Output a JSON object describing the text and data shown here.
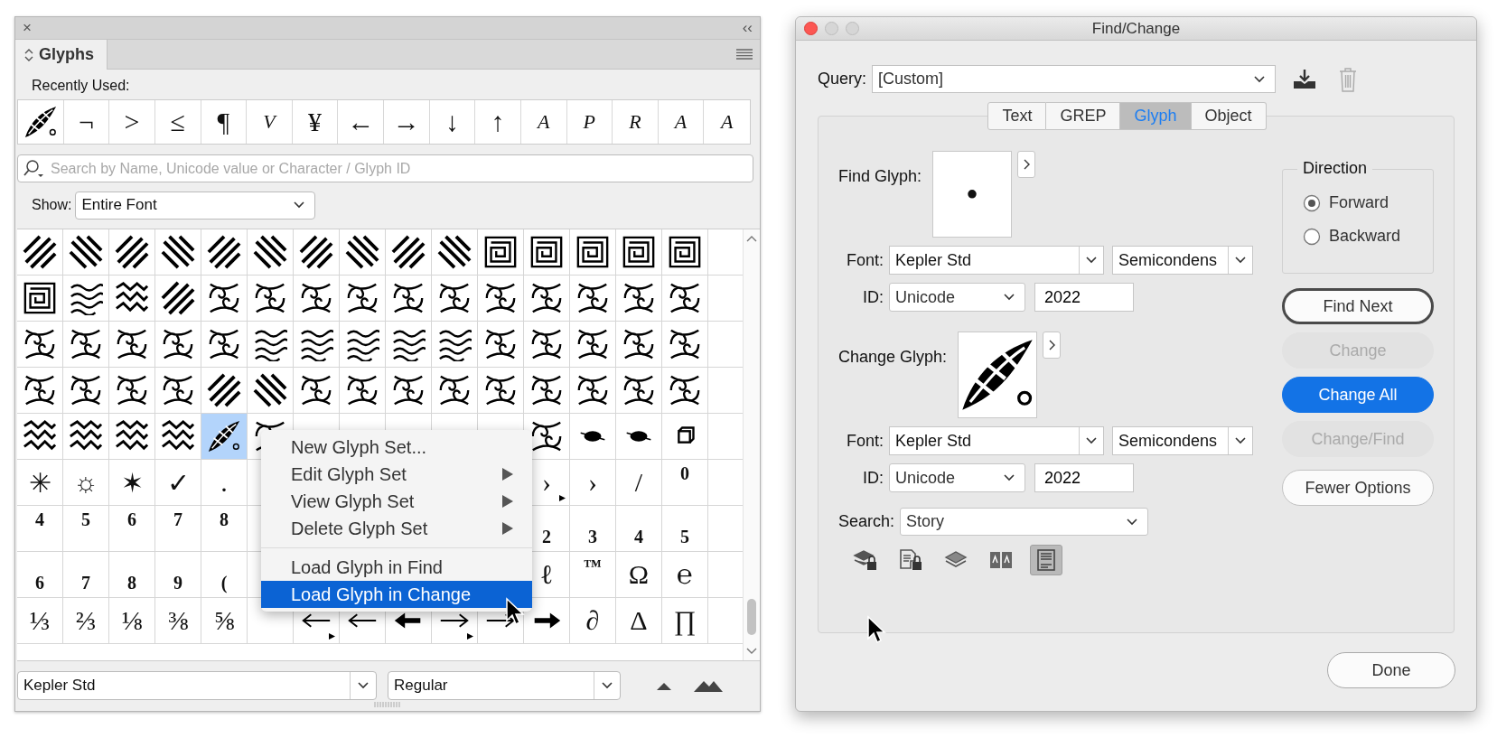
{
  "glyphs_panel": {
    "close_button": "×",
    "collapse_button": "‹‹",
    "tab": {
      "label": "Glyphs",
      "selected": true
    },
    "recently_used_label": "Recently Used:",
    "recently_used": [
      {
        "kind": "leaf"
      },
      {
        "kind": "char",
        "char": "¬"
      },
      {
        "kind": "char",
        "char": ">"
      },
      {
        "kind": "char",
        "char": "≤"
      },
      {
        "kind": "char",
        "char": "¶"
      },
      {
        "kind": "script",
        "char": "V"
      },
      {
        "kind": "char",
        "char": "¥"
      },
      {
        "kind": "char",
        "char": "←"
      },
      {
        "kind": "char",
        "char": "→"
      },
      {
        "kind": "char",
        "char": "↓"
      },
      {
        "kind": "char",
        "char": "↑"
      },
      {
        "kind": "script",
        "char": "A"
      },
      {
        "kind": "script",
        "char": "P"
      },
      {
        "kind": "script",
        "char": "R"
      },
      {
        "kind": "script",
        "char": "A"
      },
      {
        "kind": "script",
        "char": "A"
      }
    ],
    "search": {
      "placeholder": "Search by Name, Unicode value or Character / Glyph ID"
    },
    "show_label": "Show:",
    "show_value": "Entire Font",
    "grid_rows": [
      {
        "cells": [
          {
            "kind": "hatch",
            "selected": false,
            "alternates": false
          },
          {
            "kind": "hatch-back",
            "selected": false,
            "alternates": false
          },
          {
            "kind": "hatch",
            "selected": false,
            "alternates": false
          },
          {
            "kind": "hatch-back",
            "selected": false,
            "alternates": false
          },
          {
            "kind": "hatch",
            "selected": false,
            "alternates": false
          },
          {
            "kind": "hatch-back",
            "selected": false,
            "alternates": false
          },
          {
            "kind": "hatch",
            "selected": false,
            "alternates": false
          },
          {
            "kind": "hatch-back",
            "selected": false,
            "alternates": false
          },
          {
            "kind": "hatch",
            "selected": false,
            "alternates": false
          },
          {
            "kind": "hatch-back",
            "selected": false,
            "alternates": false
          },
          {
            "kind": "maze",
            "selected": false,
            "alternates": false
          },
          {
            "kind": "maze",
            "selected": false,
            "alternates": false
          },
          {
            "kind": "maze",
            "selected": false,
            "alternates": false
          },
          {
            "kind": "maze",
            "selected": false,
            "alternates": false
          },
          {
            "kind": "maze",
            "selected": false,
            "alternates": false
          }
        ]
      },
      {
        "cells": [
          {
            "kind": "maze",
            "selected": false,
            "alternates": false
          },
          {
            "kind": "wave",
            "selected": false,
            "alternates": false
          },
          {
            "kind": "zigzag",
            "selected": false,
            "alternates": false
          },
          {
            "kind": "hatch",
            "selected": false,
            "alternates": false
          },
          {
            "kind": "swirl",
            "selected": false,
            "alternates": false
          },
          {
            "kind": "swirl",
            "selected": false,
            "alternates": false
          },
          {
            "kind": "swirl",
            "selected": false,
            "alternates": false
          },
          {
            "kind": "swirl",
            "selected": false,
            "alternates": false
          },
          {
            "kind": "swirl",
            "selected": false,
            "alternates": false
          },
          {
            "kind": "swirl",
            "selected": false,
            "alternates": false
          },
          {
            "kind": "swirl",
            "selected": false,
            "alternates": false
          },
          {
            "kind": "swirl",
            "selected": false,
            "alternates": false
          },
          {
            "kind": "swirl",
            "selected": false,
            "alternates": false
          },
          {
            "kind": "swirl",
            "selected": false,
            "alternates": false
          },
          {
            "kind": "swirl",
            "selected": false,
            "alternates": false
          }
        ]
      },
      {
        "cells": [
          {
            "kind": "swirl",
            "selected": false,
            "alternates": false
          },
          {
            "kind": "swirl",
            "selected": false,
            "alternates": false
          },
          {
            "kind": "swirl",
            "selected": false,
            "alternates": false
          },
          {
            "kind": "swirl",
            "selected": false,
            "alternates": false
          },
          {
            "kind": "swirl",
            "selected": false,
            "alternates": false
          },
          {
            "kind": "wave",
            "selected": false,
            "alternates": false
          },
          {
            "kind": "wave",
            "selected": false,
            "alternates": false
          },
          {
            "kind": "wave",
            "selected": false,
            "alternates": false
          },
          {
            "kind": "wave",
            "selected": false,
            "alternates": false
          },
          {
            "kind": "wave",
            "selected": false,
            "alternates": false
          },
          {
            "kind": "swirl",
            "selected": false,
            "alternates": false
          },
          {
            "kind": "swirl",
            "selected": false,
            "alternates": false
          },
          {
            "kind": "swirl",
            "selected": false,
            "alternates": false
          },
          {
            "kind": "swirl",
            "selected": false,
            "alternates": false
          },
          {
            "kind": "swirl",
            "selected": false,
            "alternates": false
          }
        ]
      },
      {
        "cells": [
          {
            "kind": "swirl",
            "selected": false,
            "alternates": false
          },
          {
            "kind": "swirl",
            "selected": false,
            "alternates": false
          },
          {
            "kind": "swirl",
            "selected": false,
            "alternates": false
          },
          {
            "kind": "swirl",
            "selected": false,
            "alternates": false
          },
          {
            "kind": "hatch",
            "selected": false,
            "alternates": false
          },
          {
            "kind": "hatch-back",
            "selected": false,
            "alternates": false
          },
          {
            "kind": "swirl",
            "selected": false,
            "alternates": false
          },
          {
            "kind": "swirl",
            "selected": false,
            "alternates": false
          },
          {
            "kind": "swirl",
            "selected": false,
            "alternates": false
          },
          {
            "kind": "swirl",
            "selected": false,
            "alternates": false
          },
          {
            "kind": "swirl",
            "selected": false,
            "alternates": false
          },
          {
            "kind": "swirl",
            "selected": false,
            "alternates": false
          },
          {
            "kind": "swirl",
            "selected": false,
            "alternates": false
          },
          {
            "kind": "swirl",
            "selected": false,
            "alternates": false
          },
          {
            "kind": "swirl",
            "selected": false,
            "alternates": false
          }
        ]
      },
      {
        "cells": [
          {
            "kind": "zigzag",
            "selected": false,
            "alternates": false
          },
          {
            "kind": "zigzag",
            "selected": false,
            "alternates": false
          },
          {
            "kind": "zigzag",
            "selected": false,
            "alternates": false
          },
          {
            "kind": "zigzag",
            "selected": false,
            "alternates": false
          },
          {
            "kind": "leaf",
            "selected": true,
            "alternates": false
          },
          {
            "kind": "swirl"
          },
          {
            "kind": "empty"
          },
          {
            "kind": "empty"
          },
          {
            "kind": "empty"
          },
          {
            "kind": "empty"
          },
          {
            "kind": "empty"
          },
          {
            "kind": "swirl",
            "selected": false,
            "alternates": false
          },
          {
            "kind": "small-ornament",
            "selected": false,
            "alternates": false
          },
          {
            "kind": "small-ornament",
            "selected": false,
            "alternates": false
          },
          {
            "kind": "square",
            "selected": false,
            "alternates": false
          }
        ]
      },
      {
        "cells": [
          {
            "kind": "char",
            "char": "✳",
            "selected": false,
            "alternates": false
          },
          {
            "kind": "char",
            "char": "☼",
            "selected": false,
            "alternates": false
          },
          {
            "kind": "char",
            "char": "✶",
            "selected": false,
            "alternates": false
          },
          {
            "kind": "char",
            "char": "✓",
            "selected": false,
            "alternates": false
          },
          {
            "kind": "char",
            "char": ".",
            "selected": false,
            "alternates": false
          },
          {
            "kind": "empty"
          },
          {
            "kind": "empty"
          },
          {
            "kind": "empty"
          },
          {
            "kind": "empty"
          },
          {
            "kind": "empty"
          },
          {
            "kind": "empty"
          },
          {
            "kind": "char",
            "char": "›",
            "selected": false,
            "alternates": true
          },
          {
            "kind": "char",
            "char": "›",
            "selected": false,
            "alternates": false
          },
          {
            "kind": "char",
            "char": "/",
            "selected": false,
            "alternates": false
          },
          {
            "kind": "superior",
            "char": "0",
            "selected": false,
            "alternates": false
          }
        ]
      },
      {
        "cells": [
          {
            "kind": "superior",
            "char": "4",
            "selected": false,
            "alternates": false
          },
          {
            "kind": "superior",
            "char": "5",
            "selected": false,
            "alternates": false
          },
          {
            "kind": "superior",
            "char": "6",
            "selected": false,
            "alternates": false
          },
          {
            "kind": "superior",
            "char": "7",
            "selected": false,
            "alternates": false
          },
          {
            "kind": "superior",
            "char": "8",
            "selected": false,
            "alternates": false
          },
          {
            "kind": "empty"
          },
          {
            "kind": "empty"
          },
          {
            "kind": "empty"
          },
          {
            "kind": "empty"
          },
          {
            "kind": "empty"
          },
          {
            "kind": "empty"
          },
          {
            "kind": "inferior",
            "char": "2",
            "selected": false,
            "alternates": false
          },
          {
            "kind": "inferior",
            "char": "3",
            "selected": false,
            "alternates": false
          },
          {
            "kind": "inferior",
            "char": "4",
            "selected": false,
            "alternates": false
          },
          {
            "kind": "inferior",
            "char": "5",
            "selected": false,
            "alternates": false
          }
        ]
      },
      {
        "cells": [
          {
            "kind": "inferior",
            "char": "6",
            "selected": false,
            "alternates": false
          },
          {
            "kind": "inferior",
            "char": "7",
            "selected": false,
            "alternates": false
          },
          {
            "kind": "inferior",
            "char": "8",
            "selected": false,
            "alternates": false
          },
          {
            "kind": "inferior",
            "char": "9",
            "selected": false,
            "alternates": false
          },
          {
            "kind": "inferior",
            "char": "(",
            "selected": false,
            "alternates": false
          },
          {
            "kind": "empty"
          },
          {
            "kind": "empty"
          },
          {
            "kind": "empty"
          },
          {
            "kind": "empty"
          },
          {
            "kind": "empty"
          },
          {
            "kind": "empty"
          },
          {
            "kind": "char",
            "char": "ℓ",
            "selected": false,
            "alternates": false
          },
          {
            "kind": "superior",
            "char": "™",
            "selected": false,
            "alternates": false
          },
          {
            "kind": "char",
            "char": "Ω",
            "selected": false,
            "alternates": false
          },
          {
            "kind": "char",
            "char": "℮",
            "selected": false,
            "alternates": false
          }
        ]
      },
      {
        "cells": [
          {
            "kind": "char",
            "char": "⅓",
            "selected": false,
            "alternates": false
          },
          {
            "kind": "char",
            "char": "⅔",
            "selected": false,
            "alternates": false
          },
          {
            "kind": "char",
            "char": "⅛",
            "selected": false,
            "alternates": false
          },
          {
            "kind": "char",
            "char": "⅜",
            "selected": false,
            "alternates": false
          },
          {
            "kind": "char",
            "char": "⅝",
            "selected": false,
            "alternates": false
          },
          {
            "kind": "empty",
            "selected": false,
            "alternates": false
          },
          {
            "kind": "arrow-left",
            "selected": false,
            "alternates": true
          },
          {
            "kind": "arrow-left",
            "selected": false,
            "alternates": false
          },
          {
            "kind": "arrow-left-bold",
            "selected": false,
            "alternates": false
          },
          {
            "kind": "arrow-right",
            "selected": false,
            "alternates": true
          },
          {
            "kind": "arrow-right",
            "selected": false,
            "alternates": false
          },
          {
            "kind": "arrow-right-bold",
            "selected": false,
            "alternates": false
          },
          {
            "kind": "char",
            "char": "∂",
            "selected": false,
            "alternates": false
          },
          {
            "kind": "char",
            "char": "Δ",
            "selected": false,
            "alternates": false
          },
          {
            "kind": "char",
            "char": "∏",
            "selected": false,
            "alternates": false
          }
        ]
      }
    ],
    "font": "Kepler Std",
    "style": "Regular",
    "context_menu": [
      {
        "kind": "item",
        "label": "New Glyph Set...",
        "submenu": false,
        "selected": false
      },
      {
        "kind": "item",
        "label": "Edit Glyph Set",
        "submenu": true,
        "selected": false
      },
      {
        "kind": "item",
        "label": "View Glyph Set",
        "submenu": true,
        "selected": false
      },
      {
        "kind": "item",
        "label": "Delete Glyph Set",
        "submenu": true,
        "selected": false
      },
      {
        "kind": "separator"
      },
      {
        "kind": "item",
        "label": "Load Glyph in Find",
        "submenu": false,
        "selected": false
      },
      {
        "kind": "item",
        "label": "Load Glyph in Change",
        "submenu": false,
        "selected": true
      }
    ]
  },
  "find_change": {
    "title": "Find/Change",
    "query_label": "Query:",
    "query_value": "[Custom]",
    "tabs": [
      {
        "label": "Text",
        "selected": false
      },
      {
        "label": "GREP",
        "selected": false
      },
      {
        "label": "Glyph",
        "selected": true
      },
      {
        "label": "Object",
        "selected": false
      }
    ],
    "find": {
      "label": "Find Glyph:",
      "kind": "char",
      "glyph": "•",
      "font_label": "Font:",
      "font": "Kepler Std",
      "style": "Semicondens",
      "id_label": "ID:",
      "id_type": "Unicode",
      "id_value": "2022"
    },
    "change": {
      "label": "Change Glyph:",
      "kind": "leaf",
      "font_label": "Font:",
      "font": "Kepler Std",
      "style": "Semicondens",
      "id_label": "ID:",
      "id_type": "Unicode",
      "id_value": "2022"
    },
    "search_label": "Search:",
    "search_value": "Story",
    "search_options": [
      {
        "kind": "locked-layers",
        "on": false
      },
      {
        "kind": "locked-stories",
        "on": false
      },
      {
        "kind": "hidden-layers",
        "on": false
      },
      {
        "kind": "master-pages",
        "on": false
      },
      {
        "kind": "footnotes",
        "on": true
      }
    ],
    "direction": {
      "title": "Direction",
      "options": [
        {
          "label": "Forward",
          "selected": true
        },
        {
          "label": "Backward",
          "selected": false
        }
      ]
    },
    "buttons": [
      {
        "label": "Find Next",
        "disabled": false,
        "primary": false,
        "focused": true
      },
      {
        "label": "Change",
        "disabled": true,
        "primary": false,
        "focused": false
      },
      {
        "label": "Change All",
        "disabled": false,
        "primary": true,
        "focused": false
      },
      {
        "label": "Change/Find",
        "disabled": true,
        "primary": false,
        "focused": false
      },
      {
        "label": "Fewer Options",
        "disabled": false,
        "primary": false,
        "focused": false
      }
    ],
    "done_button": "Done"
  }
}
